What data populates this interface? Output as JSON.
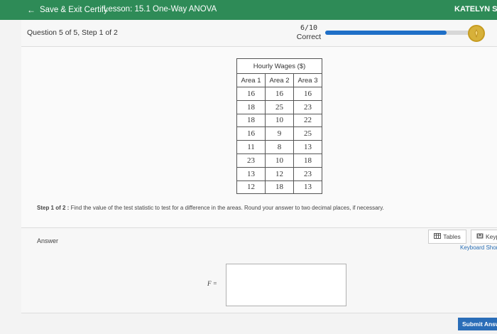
{
  "topbar": {
    "back_label": "Save & Exit Certify",
    "lesson": "Lesson: 15.1 One-Way ANOVA",
    "user": "KATELYN SMITH"
  },
  "question": {
    "title": "Question 5 of 5, Step 1 of 2",
    "score": "6/10",
    "score_status": "Correct",
    "progress_fraction": 0.8
  },
  "table": {
    "caption": "Hourly Wages ($)",
    "headers": [
      "Area 1",
      "Area 2",
      "Area 3"
    ],
    "rows": [
      [
        "16",
        "16",
        "16"
      ],
      [
        "18",
        "25",
        "23"
      ],
      [
        "18",
        "10",
        "22"
      ],
      [
        "16",
        "9",
        "25"
      ],
      [
        "11",
        "8",
        "13"
      ],
      [
        "23",
        "10",
        "18"
      ],
      [
        "13",
        "12",
        "23"
      ],
      [
        "12",
        "18",
        "13"
      ]
    ]
  },
  "step": {
    "prefix": "Step 1 of 2 :",
    "text": "Find the value of the test statistic to test for a difference in the areas. Round your answer to two decimal places, if necessary."
  },
  "answer": {
    "label": "Answer",
    "tables_button": "Tables",
    "keypad_button": "Keypad",
    "keyboard_shortcuts": "Keyboard Shortcuts",
    "f_label": "F =",
    "value": ""
  },
  "footer": {
    "submit_label": "Submit Answer"
  },
  "colors": {
    "topbar": "#2e8b57",
    "progress": "#1f6fc7",
    "submit": "#2a6db8",
    "badge": "#d7b13a"
  }
}
